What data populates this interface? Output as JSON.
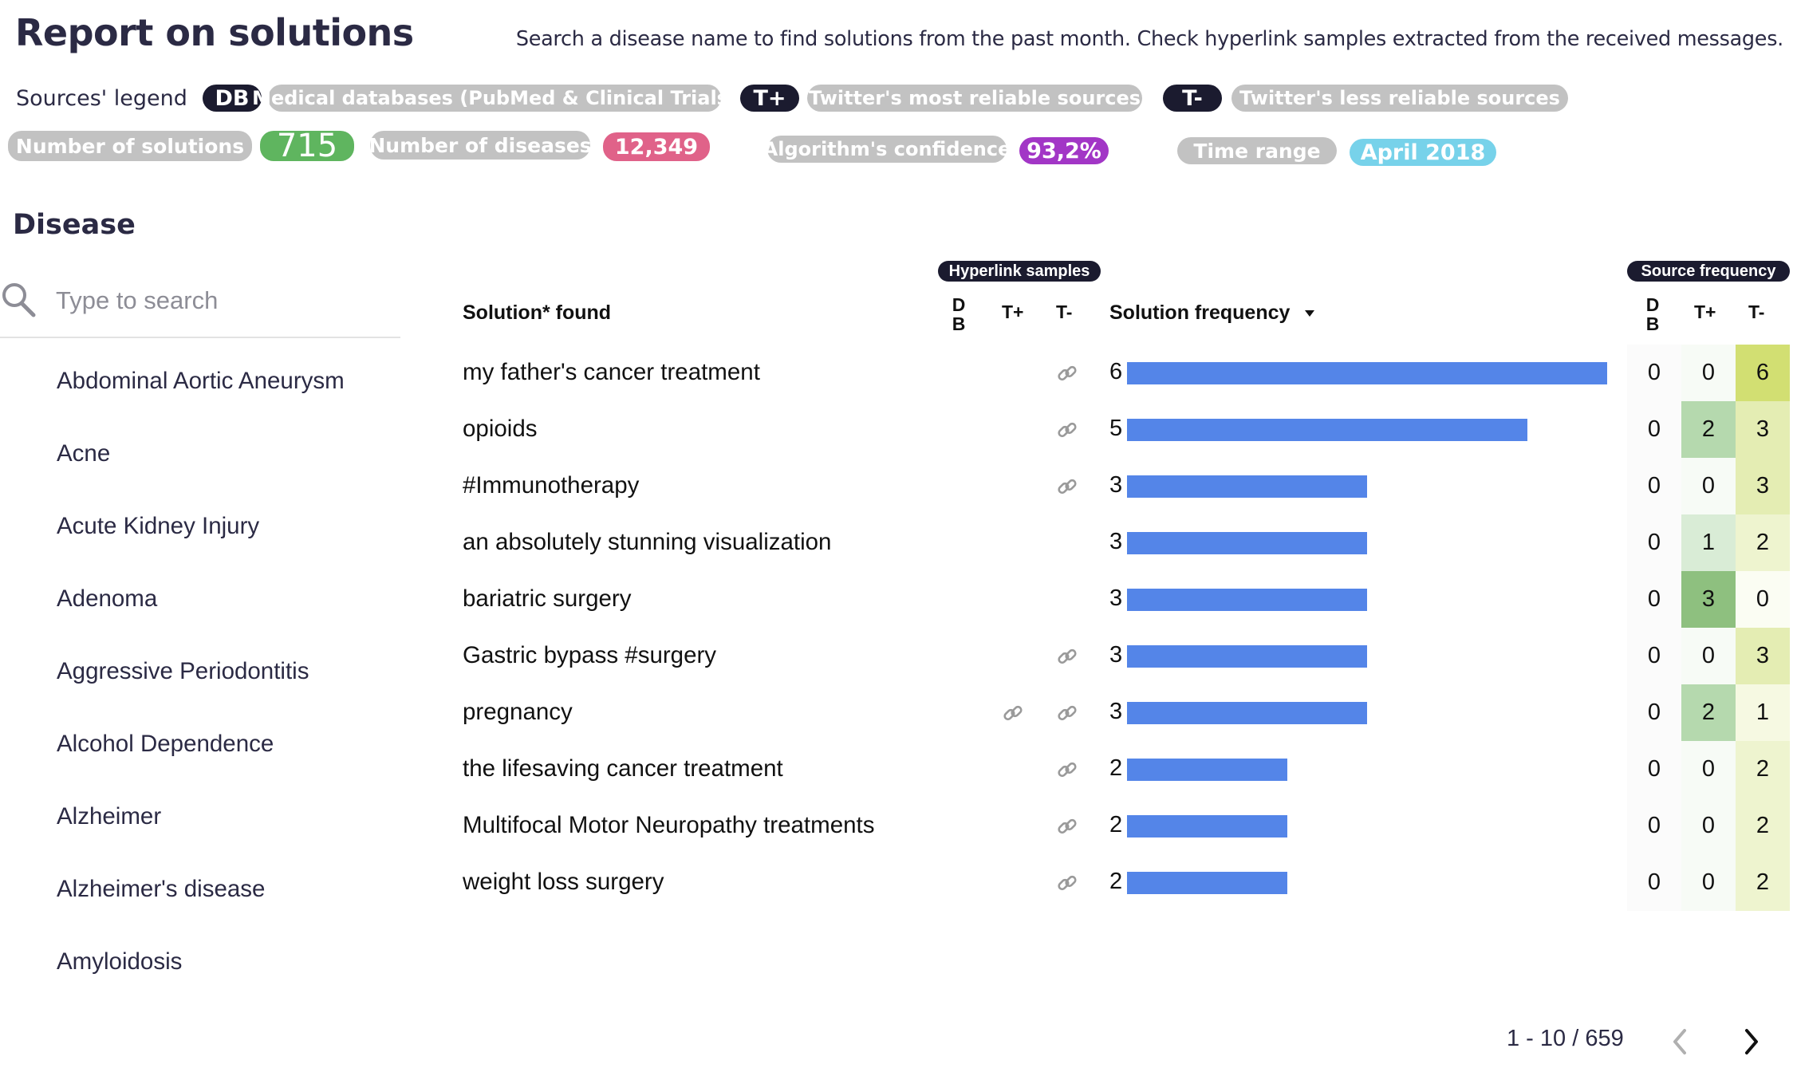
{
  "header": {
    "title": "Report on solutions",
    "subtitle": "Search a disease name to find solutions from the past month. Check hyperlink samples extracted from the received messages."
  },
  "legend": {
    "label": "Sources' legend",
    "items": [
      {
        "tag": "DB",
        "desc": "Medical databases (PubMed & Clinical Trials)"
      },
      {
        "tag": "T+",
        "desc": "Twitter's most reliable sources"
      },
      {
        "tag": "T-",
        "desc": "Twitter's less reliable sources"
      }
    ]
  },
  "stats": {
    "solutions_label": "Number of solutions",
    "solutions_value": "715",
    "diseases_label": "Number of diseases",
    "diseases_value": "12,349",
    "confidence_label": "Algorithm's confidence",
    "confidence_value": "93,2%",
    "time_label": "Time range",
    "time_value": "April 2018"
  },
  "sidebar": {
    "heading": "Disease",
    "search_placeholder": "Type to search",
    "diseases": [
      "Abdominal Aortic Aneurysm",
      "Acne",
      "Acute Kidney Injury",
      "Adenoma",
      "Aggressive Periodontitis",
      "Alcohol Dependence",
      "Alzheimer",
      "Alzheimer's disease",
      "Amyloidosis"
    ]
  },
  "table": {
    "hyperlink_badge": "Hyperlink samples",
    "source_badge": "Source frequency",
    "col_solution": "Solution* found",
    "col_db": "D B",
    "col_db_top": "D",
    "col_db_bottom": "B",
    "col_tplus": "T+",
    "col_tminus": "T-",
    "col_freq": "Solution frequency",
    "sort_icon": "sort-desc-triangle",
    "rows": [
      {
        "solution": "my father's cancer treatment",
        "link_db": false,
        "link_tplus": false,
        "link_tminus": true,
        "freq": 6,
        "db": 0,
        "tplus": 0,
        "tminus": 6
      },
      {
        "solution": "opioids",
        "link_db": false,
        "link_tplus": false,
        "link_tminus": true,
        "freq": 5,
        "db": 0,
        "tplus": 2,
        "tminus": 3
      },
      {
        "solution": "#Immunotherapy",
        "link_db": false,
        "link_tplus": false,
        "link_tminus": true,
        "freq": 3,
        "db": 0,
        "tplus": 0,
        "tminus": 3
      },
      {
        "solution": "an absolutely stunning visualization",
        "link_db": false,
        "link_tplus": false,
        "link_tminus": false,
        "freq": 3,
        "db": 0,
        "tplus": 1,
        "tminus": 2
      },
      {
        "solution": "bariatric surgery",
        "link_db": false,
        "link_tplus": false,
        "link_tminus": false,
        "freq": 3,
        "db": 0,
        "tplus": 3,
        "tminus": 0
      },
      {
        "solution": "Gastric bypass #surgery",
        "link_db": false,
        "link_tplus": false,
        "link_tminus": true,
        "freq": 3,
        "db": 0,
        "tplus": 0,
        "tminus": 3
      },
      {
        "solution": "pregnancy",
        "link_db": false,
        "link_tplus": true,
        "link_tminus": true,
        "freq": 3,
        "db": 0,
        "tplus": 2,
        "tminus": 1
      },
      {
        "solution": "the lifesaving cancer treatment",
        "link_db": false,
        "link_tplus": false,
        "link_tminus": true,
        "freq": 2,
        "db": 0,
        "tplus": 0,
        "tminus": 2
      },
      {
        "solution": "Multifocal Motor Neuropathy treatments",
        "link_db": false,
        "link_tplus": false,
        "link_tminus": true,
        "freq": 2,
        "db": 0,
        "tplus": 0,
        "tminus": 2
      },
      {
        "solution": "weight loss surgery",
        "link_db": false,
        "link_tplus": false,
        "link_tminus": true,
        "freq": 2,
        "db": 0,
        "tplus": 0,
        "tminus": 2
      }
    ],
    "freq_max": 6
  },
  "heat_colors": {
    "tplus": {
      "0": "#f7fbf6",
      "1": "#d9ecd6",
      "2": "#b5d9ae",
      "3": "#8ec07f"
    },
    "tminus": {
      "0": "#fbfdf3",
      "1": "#f6f9e2",
      "2": "#eef4cf",
      "3": "#e4edb3",
      "6": "#d2df72"
    },
    "db": {
      "0": "#fbfbfb"
    }
  },
  "pager": {
    "label": "1 - 10 / 659",
    "prev_icon": "chevron-left-icon",
    "next_icon": "chevron-right-icon"
  }
}
